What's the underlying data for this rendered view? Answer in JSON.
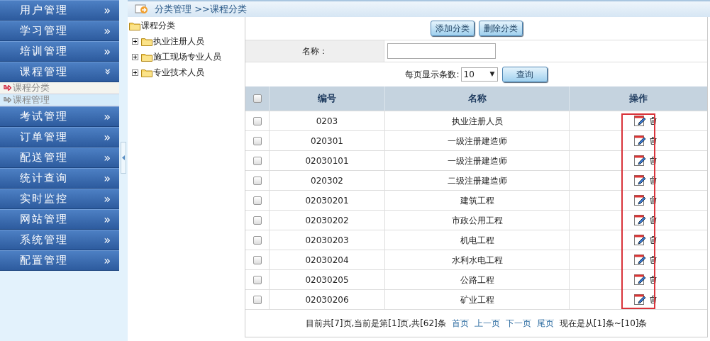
{
  "sidebar": {
    "menus": [
      {
        "label": "用户管理",
        "icon": "»",
        "expanded": false
      },
      {
        "label": "学习管理",
        "icon": "»",
        "expanded": false
      },
      {
        "label": "培训管理",
        "icon": "»",
        "expanded": false
      },
      {
        "label": "课程管理",
        "icon": "»",
        "expanded": true,
        "children": [
          {
            "label": "课程分类",
            "selected": true
          },
          {
            "label": "课程管理",
            "selected": false
          }
        ]
      },
      {
        "label": "考试管理",
        "icon": "»",
        "expanded": false
      },
      {
        "label": "订单管理",
        "icon": "»",
        "expanded": false
      },
      {
        "label": "配送管理",
        "icon": "»",
        "expanded": false
      },
      {
        "label": "统计查询",
        "icon": "»",
        "expanded": false
      },
      {
        "label": "实时监控",
        "icon": "»",
        "expanded": false
      },
      {
        "label": "网站管理",
        "icon": "»",
        "expanded": false
      },
      {
        "label": "系统管理",
        "icon": "»",
        "expanded": false
      },
      {
        "label": "配置管理",
        "icon": "»",
        "expanded": false
      }
    ]
  },
  "breadcrumb": "分类管理 >>课程分类",
  "tree": {
    "root": "课程分类",
    "children": [
      {
        "label": "执业注册人员",
        "expanded": false
      },
      {
        "label": "施工现场专业人员",
        "expanded": false
      },
      {
        "label": "专业技术人员",
        "expanded": false
      }
    ]
  },
  "toolbar": {
    "buttons": [
      "添加分类",
      "删除分类"
    ]
  },
  "filter": {
    "label": "名称："
  },
  "page_size": {
    "label": "每页显示条数:",
    "value": "10",
    "caret": "▼"
  },
  "search_button": "查询",
  "table": {
    "all_checked": false,
    "columns": [
      "编号",
      "名称",
      "操作"
    ],
    "actions_highlighted": true,
    "rows": [
      {
        "checked": false,
        "code": "0203",
        "name": "执业注册人员"
      },
      {
        "checked": false,
        "code": "020301",
        "name": "一级注册建造师"
      },
      {
        "checked": false,
        "code": "02030101",
        "name": "一级注册建造师"
      },
      {
        "checked": false,
        "code": "020302",
        "name": "二级注册建造师"
      },
      {
        "checked": false,
        "code": "02030201",
        "name": "建筑工程"
      },
      {
        "checked": false,
        "code": "02030202",
        "name": "市政公用工程"
      },
      {
        "checked": false,
        "code": "02030203",
        "name": "机电工程"
      },
      {
        "checked": false,
        "code": "02030204",
        "name": "水利水电工程"
      },
      {
        "checked": false,
        "code": "02030205",
        "name": "公路工程"
      },
      {
        "checked": false,
        "code": "02030206",
        "name": "矿业工程"
      }
    ]
  },
  "pager": {
    "summary": "目前共[7]页,当前是第[1]页,共[62]条",
    "links": [
      "首页",
      "上一页",
      "下一页",
      "尾页"
    ],
    "range": "现在是从[1]条~[10]条"
  }
}
